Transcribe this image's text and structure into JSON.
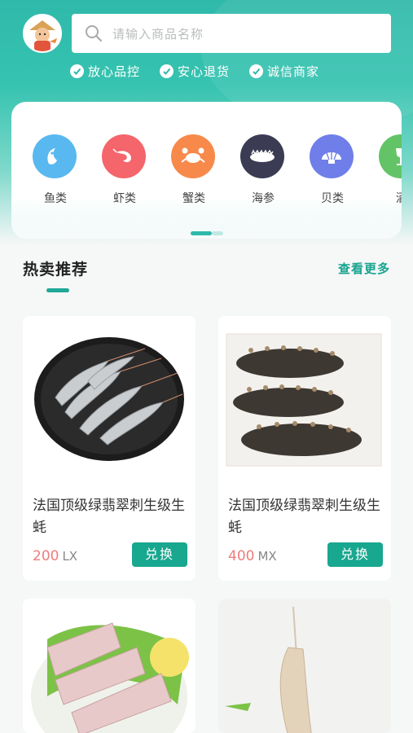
{
  "search": {
    "placeholder": "请输入商品名称"
  },
  "badges": [
    "放心品控",
    "安心退货",
    "诚信商家"
  ],
  "categories": [
    {
      "label": "鱼类",
      "icon": "fish-icon",
      "color": "#59b8ef"
    },
    {
      "label": "虾类",
      "icon": "shrimp-icon",
      "color": "#f4656c"
    },
    {
      "label": "蟹类",
      "icon": "crab-icon",
      "color": "#f7894b"
    },
    {
      "label": "海参",
      "icon": "sea-cucumber-icon",
      "color": "#3b3b54"
    },
    {
      "label": "贝类",
      "icon": "shell-icon",
      "color": "#6f7ee8"
    },
    {
      "label": "酒",
      "icon": "wine-icon",
      "color": "#63c467"
    }
  ],
  "section": {
    "title": "热卖推荐",
    "more": "查看更多"
  },
  "products": [
    {
      "name": "法国顶级绿翡翠刺生级生蚝",
      "price": "200",
      "unit": "LX",
      "action": "兑换"
    },
    {
      "name": "法国顶级绿翡翠刺生级生蚝",
      "price": "400",
      "unit": "MX",
      "action": "兑换"
    }
  ],
  "colors": {
    "primary": "#18a78f",
    "price": "#f07c7c",
    "header": "#2fb9aa"
  }
}
